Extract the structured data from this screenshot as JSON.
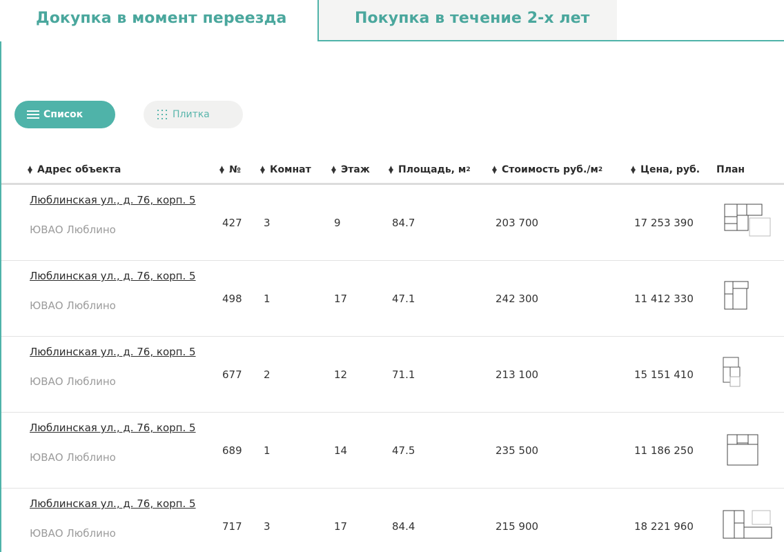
{
  "tabs": [
    {
      "label": "Докупка в момент переезда",
      "active": true
    },
    {
      "label": "Покупка в течение 2-х лет",
      "active": false
    }
  ],
  "view_toggle": {
    "list_label": "Список",
    "tile_label": "Плитка",
    "active": "list"
  },
  "table": {
    "headers": {
      "address": "Адрес объекта",
      "number": "№",
      "rooms": "Комнат",
      "floor": "Этаж",
      "area": "Площадь, м",
      "area_sup": "2",
      "price_per_m": "Стоимость руб./м",
      "price_per_m_sup": "2",
      "price": "Цена, руб.",
      "plan": "План"
    },
    "rows": [
      {
        "address": "Люблинская ул., д. 76, корп. 5",
        "district": "ЮВАО Люблино",
        "number": "427",
        "rooms": "3",
        "floor": "9",
        "area": "84.7",
        "price_per_m": "203 700",
        "price": "17 253 390"
      },
      {
        "address": "Люблинская ул., д. 76, корп. 5",
        "district": "ЮВАО Люблино",
        "number": "498",
        "rooms": "1",
        "floor": "17",
        "area": "47.1",
        "price_per_m": "242 300",
        "price": "11 412 330"
      },
      {
        "address": "Люблинская ул., д. 76, корп. 5",
        "district": "ЮВАО Люблино",
        "number": "677",
        "rooms": "2",
        "floor": "12",
        "area": "71.1",
        "price_per_m": "213 100",
        "price": "15 151 410"
      },
      {
        "address": "Люблинская ул., д. 76, корп. 5",
        "district": "ЮВАО Люблино",
        "number": "689",
        "rooms": "1",
        "floor": "14",
        "area": "47.5",
        "price_per_m": "235 500",
        "price": "11 186 250"
      },
      {
        "address": "Люблинская ул., д. 76, корп. 5",
        "district": "ЮВАО Люблино",
        "number": "717",
        "rooms": "3",
        "floor": "17",
        "area": "84.4",
        "price_per_m": "215 900",
        "price": "18 221 960"
      }
    ]
  },
  "colors": {
    "accent": "#4fb3a9",
    "tab_text": "#4aa79d",
    "muted": "#9b9b9b"
  }
}
